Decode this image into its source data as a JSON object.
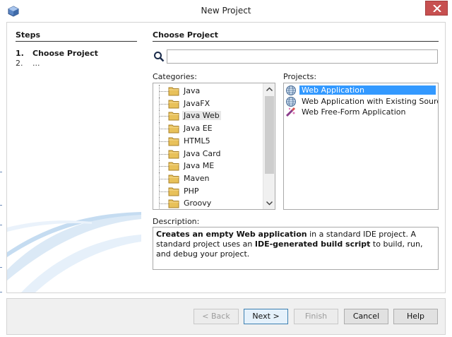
{
  "window": {
    "title": "New Project"
  },
  "steps": {
    "heading": "Steps",
    "items": [
      {
        "num": "1.",
        "label": "Choose Project"
      },
      {
        "num": "2.",
        "label": "..."
      }
    ]
  },
  "main": {
    "heading": "Choose Project",
    "search": {
      "value": "",
      "placeholder": ""
    },
    "categories_label": "Categories:",
    "projects_label": "Projects:",
    "categories": [
      "Java",
      "JavaFX",
      "Java Web",
      "Java EE",
      "HTML5",
      "Java Card",
      "Java ME",
      "Maven",
      "PHP",
      "Groovy"
    ],
    "selected_category": "Java Web",
    "projects": [
      "Web Application",
      "Web Application with Existing Sources",
      "Web Free-Form Application"
    ],
    "selected_project": "Web Application",
    "description_label": "Description:",
    "description": {
      "bold1": "Creates an empty Web application",
      "text1": " in a standard IDE project. A standard project uses an ",
      "bold2": "IDE-generated build script",
      "text2": " to build, run, and debug your project."
    }
  },
  "buttons": {
    "back": "< Back",
    "next": "Next >",
    "finish": "Finish",
    "cancel": "Cancel",
    "help": "Help"
  },
  "colors": {
    "selection": "#3399ff",
    "close": "#c75050",
    "folder": "#e8c15a"
  },
  "icons": {
    "app": "netbeans-cube-icon",
    "close": "close-icon",
    "search": "search-icon",
    "folder": "folder-icon",
    "web": "globe-icon",
    "freeform": "wand-icon"
  }
}
